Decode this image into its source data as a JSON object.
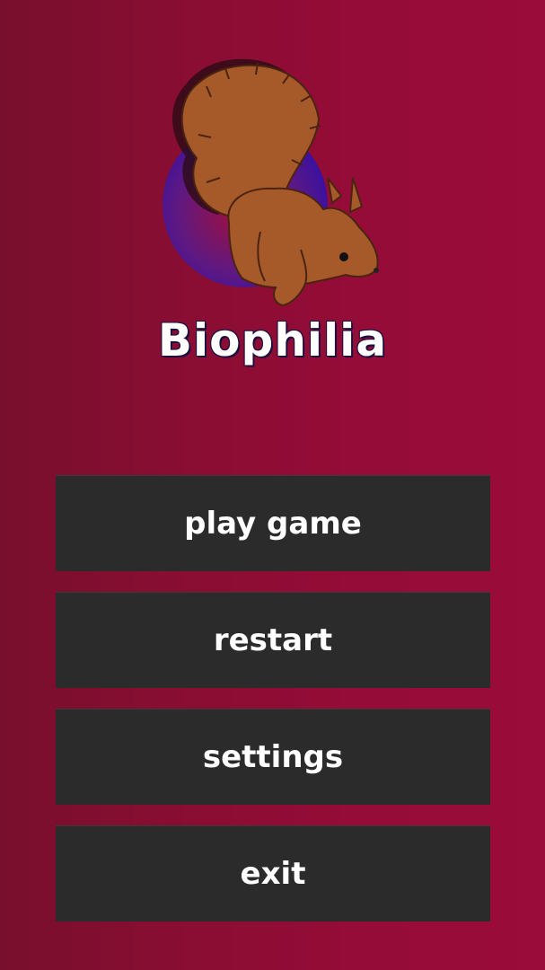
{
  "game": {
    "title": "Biophilia"
  },
  "menu": {
    "items": [
      {
        "label": "play game"
      },
      {
        "label": "restart"
      },
      {
        "label": "settings"
      },
      {
        "label": "exit"
      }
    ]
  },
  "colors": {
    "background_left": "#780f2c",
    "background_right": "#9a0c3a",
    "button_bg": "#2b2b2b",
    "button_text": "#ffffff",
    "title_outline": "#1b0f3d",
    "logo_circle": "#3a1a9a",
    "squirrel_fur": "#a65a2a"
  },
  "icons": {
    "logo": "squirrel-logo-icon"
  }
}
